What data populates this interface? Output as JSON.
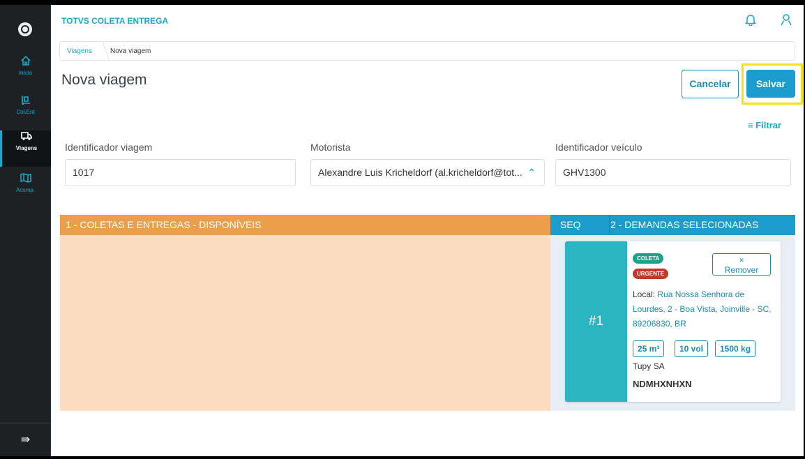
{
  "app": {
    "title": "TOTVS COLETA ENTREGA"
  },
  "sidebar": {
    "items": [
      {
        "label": "Início",
        "icon": "home-icon"
      },
      {
        "label": "Col.Ent",
        "icon": "dolly-icon"
      },
      {
        "label": "Viagens",
        "icon": "truck-icon",
        "active": true
      },
      {
        "label": "Acomp.",
        "icon": "map-icon"
      }
    ]
  },
  "breadcrumb": {
    "link": "Viagens",
    "current": "Nova viagem"
  },
  "page": {
    "title": "Nova viagem"
  },
  "actions": {
    "cancel": "Cancelar",
    "save": "Salvar",
    "filter": "Filtrar"
  },
  "form": {
    "trip_id": {
      "label": "Identificador viagem",
      "value": "1017"
    },
    "driver": {
      "label": "Motorista",
      "value": "Alexandre Luis Kricheldorf (al.kricheldorf@tot..."
    },
    "vehicle_id": {
      "label": "Identificador veículo",
      "value": "GHV1300"
    }
  },
  "panels": {
    "available_title": "1 - COLETAS E ENTREGAS - DISPONÍVEIS",
    "seq_label": "SEQ",
    "selected_title": "2 - DEMANDAS SELECIONADAS"
  },
  "card": {
    "number": "#1",
    "badge_type": "COLETA",
    "badge_priority": "URGENTE",
    "remove_x": "×",
    "remove_label": "Remover",
    "local_label": "Local:",
    "address": "Rua Nossa Senhora de Lourdes, 2 - Boa Vista, Joinville - SC, 89206830, BR",
    "volume": "25 m³",
    "vol": "10 vol",
    "weight": "1500 kg",
    "company": "Tupy SA",
    "code": "NDMHXNHXN"
  },
  "colors": {
    "accent": "#1aa9c6",
    "sidebar_bg": "#1e2124",
    "available_header": "#eb9f4b",
    "available_body": "#fbdcc0",
    "selected_header": "#1a9ccc",
    "card_number_bg": "#2bb4c2",
    "highlight": "#f7e113"
  }
}
